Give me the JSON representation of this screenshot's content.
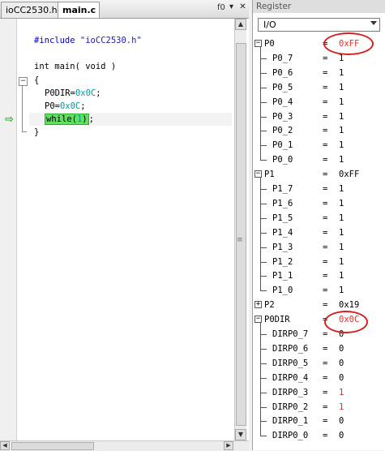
{
  "editor": {
    "tabs": [
      {
        "label": "ioCC2530.h"
      },
      {
        "label": "main.c"
      }
    ],
    "function_label": "f0",
    "tab_icons": "▾ ✕",
    "code_lines": [
      "#include \"ioCC2530.h\"",
      "int main( void )",
      "{",
      "P0DIR=0x0C;",
      "P0=0x0C;",
      "while(1);",
      "}"
    ]
  },
  "register": {
    "title": "Register",
    "selector_value": "I/O",
    "groups": [
      {
        "name": "P0",
        "value": "0xFF",
        "expanded": true,
        "bits": [
          {
            "name": "P0_7",
            "value": "1"
          },
          {
            "name": "P0_6",
            "value": "1"
          },
          {
            "name": "P0_5",
            "value": "1"
          },
          {
            "name": "P0_4",
            "value": "1"
          },
          {
            "name": "P0_3",
            "value": "1"
          },
          {
            "name": "P0_2",
            "value": "1"
          },
          {
            "name": "P0_1",
            "value": "1"
          },
          {
            "name": "P0_0",
            "value": "1"
          }
        ]
      },
      {
        "name": "P1",
        "value": "0xFF",
        "expanded": true,
        "bits": [
          {
            "name": "P1_7",
            "value": "1"
          },
          {
            "name": "P1_6",
            "value": "1"
          },
          {
            "name": "P1_5",
            "value": "1"
          },
          {
            "name": "P1_4",
            "value": "1"
          },
          {
            "name": "P1_3",
            "value": "1"
          },
          {
            "name": "P1_2",
            "value": "1"
          },
          {
            "name": "P1_1",
            "value": "1"
          },
          {
            "name": "P1_0",
            "value": "1"
          }
        ]
      },
      {
        "name": "P2",
        "value": "0x19",
        "expanded": false,
        "bits": []
      },
      {
        "name": "P0DIR",
        "value": "0x0C",
        "expanded": true,
        "bits": [
          {
            "name": "DIRP0_7",
            "value": "0"
          },
          {
            "name": "DIRP0_6",
            "value": "0"
          },
          {
            "name": "DIRP0_5",
            "value": "0"
          },
          {
            "name": "DIRP0_4",
            "value": "0"
          },
          {
            "name": "DIRP0_3",
            "value": "1"
          },
          {
            "name": "DIRP0_2",
            "value": "1"
          },
          {
            "name": "DIRP0_1",
            "value": "0"
          },
          {
            "name": "DIRP0_0",
            "value": "0"
          }
        ]
      }
    ],
    "changed_color": "#e03030",
    "annotation_color": "#d42020"
  },
  "colors": {
    "while_highlight": "#5fe05f",
    "pc_arrow": "#14b814",
    "string": "#1d1db3",
    "number": "#009b9b"
  }
}
